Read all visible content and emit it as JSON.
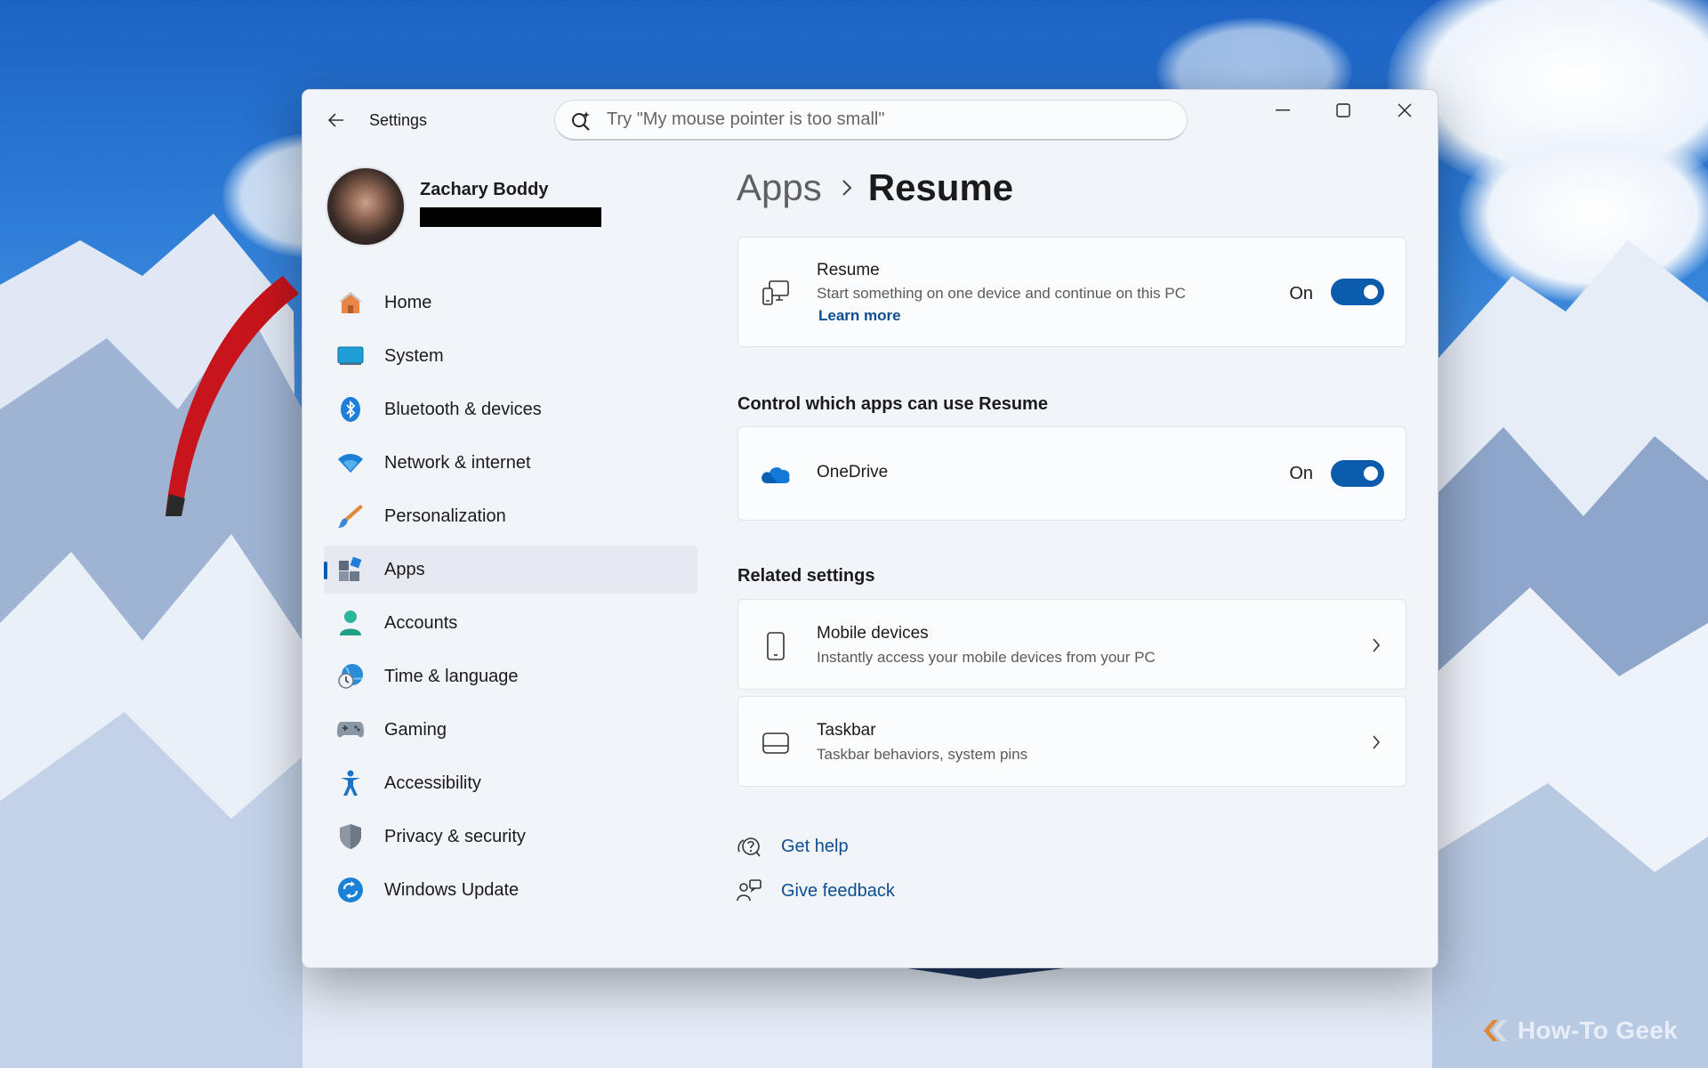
{
  "window": {
    "app_title": "Settings",
    "search_placeholder": "Try \"My mouse pointer is too small\""
  },
  "profile": {
    "name": "Zachary Boddy"
  },
  "nav": [
    {
      "label": "Home",
      "icon": "home-icon"
    },
    {
      "label": "System",
      "icon": "system-icon"
    },
    {
      "label": "Bluetooth & devices",
      "icon": "bluetooth-icon"
    },
    {
      "label": "Network & internet",
      "icon": "wifi-icon"
    },
    {
      "label": "Personalization",
      "icon": "brush-icon"
    },
    {
      "label": "Apps",
      "icon": "apps-icon",
      "selected": true
    },
    {
      "label": "Accounts",
      "icon": "account-icon"
    },
    {
      "label": "Time & language",
      "icon": "globe-clock-icon"
    },
    {
      "label": "Gaming",
      "icon": "gamepad-icon"
    },
    {
      "label": "Accessibility",
      "icon": "accessibility-icon"
    },
    {
      "label": "Privacy & security",
      "icon": "shield-icon"
    },
    {
      "label": "Windows Update",
      "icon": "update-icon"
    }
  ],
  "breadcrumb": {
    "parent": "Apps",
    "current": "Resume"
  },
  "resume_card": {
    "title": "Resume",
    "description": "Start something on one device and continue on this PC",
    "link": "Learn more",
    "toggle_label": "On",
    "toggle_on": true,
    "icon": "devices-icon"
  },
  "control_section": {
    "title": "Control which apps can use Resume",
    "apps": [
      {
        "name": "OneDrive",
        "toggle_label": "On",
        "toggle_on": true,
        "icon": "onedrive-icon"
      }
    ]
  },
  "related_section": {
    "title": "Related settings",
    "items": [
      {
        "title": "Mobile devices",
        "description": "Instantly access your mobile devices from your PC",
        "icon": "phone-icon"
      },
      {
        "title": "Taskbar",
        "description": "Taskbar behaviors, system pins",
        "icon": "taskbar-icon"
      }
    ]
  },
  "help": {
    "get_help": "Get help",
    "give_feedback": "Give feedback"
  },
  "watermark": "How-To Geek",
  "colors": {
    "accent": "#0b5cad",
    "link": "#0b4e91",
    "window_bg": "#f1f4f9",
    "card_bg": "#fbfcfd"
  }
}
